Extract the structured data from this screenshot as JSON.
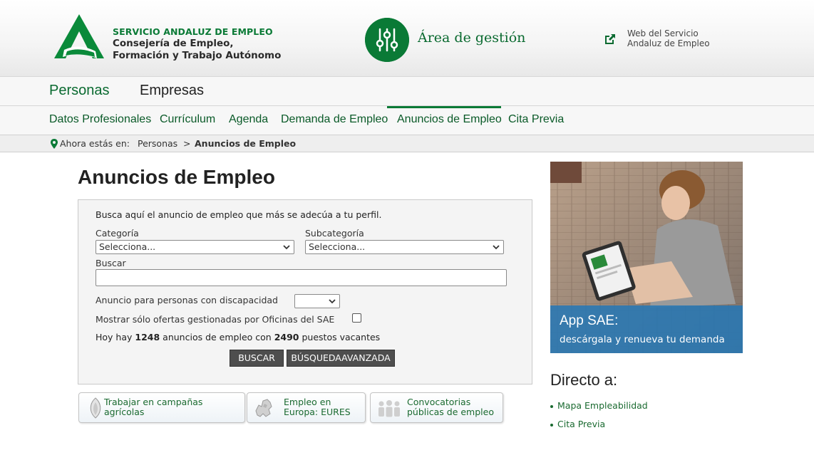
{
  "header": {
    "org_name": "SERVICIO ANDALUZ DE EMPLEO",
    "org_sub_1": "Consejería de Empleo,",
    "org_sub_2": "Formación y Trabajo Autónomo",
    "area_title": "Área de gestión",
    "ext_link_line_1": "Web del Servicio",
    "ext_link_line_2": "Andaluz de Empleo"
  },
  "nav_primary": {
    "items": [
      {
        "label": "Personas",
        "active": true
      },
      {
        "label": "Empresas",
        "active": false
      }
    ]
  },
  "nav_secondary": {
    "items": [
      {
        "label": "Datos Profesionales"
      },
      {
        "label": "Currículum"
      },
      {
        "label": "Agenda"
      },
      {
        "label": "Demanda de Empleo"
      },
      {
        "label": "Anuncios de Empleo",
        "active": true
      },
      {
        "label": "Cita Previa"
      }
    ]
  },
  "breadcrumb": {
    "prefix": "Ahora estás en:",
    "items": [
      "Personas",
      "Anuncios de Empleo"
    ],
    "separator": ">"
  },
  "main": {
    "title": "Anuncios de Empleo",
    "search": {
      "intro": "Busca aquí el anuncio de empleo que más se adecúa a tu perfil.",
      "categoria_label": "Categoría",
      "categoria_value": "Selecciona...",
      "subcategoria_label": "Subcategoría",
      "subcategoria_value": "Selecciona...",
      "buscar_label": "Buscar",
      "buscar_value": "",
      "discapacidad_label": "Anuncio para personas con discapacidad",
      "discapacidad_value": "",
      "sae_label": "Mostrar sólo ofertas gestionadas por Oficinas del SAE",
      "sae_checked": false,
      "stats_prefix": "Hoy hay",
      "stats_anuncios": "1248",
      "stats_middle": "anuncios de empleo con",
      "stats_puestos": "2490",
      "stats_suffix": "puestos vacantes",
      "btn_buscar": "BUSCAR",
      "btn_avanzada": "BÚSQUEDAAVANZADA"
    }
  },
  "quick_links": [
    {
      "line1": "Trabajar en campañas",
      "line2": "agrícolas",
      "icon": "leaf-icon"
    },
    {
      "line1": "Empleo en",
      "line2": "Europa: EURES",
      "icon": "europe-map-icon"
    },
    {
      "line1": "Convocatorias",
      "line2": "públicas de empleo",
      "icon": "people-icon"
    }
  ],
  "promo": {
    "title": "App SAE:",
    "subtitle": "descárgala y renueva tu demanda"
  },
  "directo": {
    "title": "Directo a:",
    "links": [
      "Mapa Empleabilidad",
      "Cita Previa"
    ]
  },
  "colors": {
    "brand_green": "#0a7a36",
    "promo_band": "#2878b4",
    "button_dark": "#4e4e4e"
  }
}
